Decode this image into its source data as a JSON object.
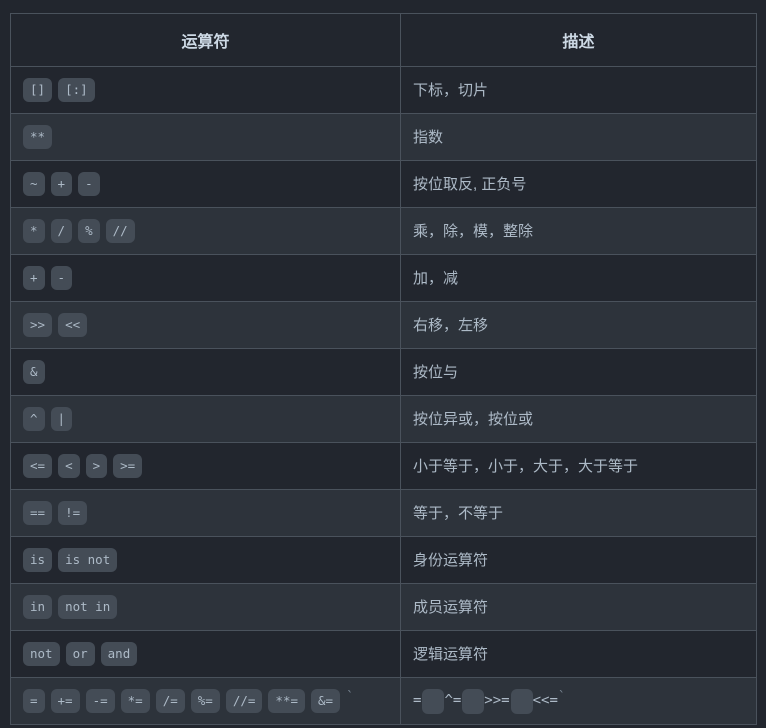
{
  "table": {
    "headers": {
      "operator": "运算符",
      "description": "描述"
    },
    "rows": [
      {
        "operators": [
          "[]",
          "[:]"
        ],
        "description": "下标，切片"
      },
      {
        "operators": [
          "**"
        ],
        "description": "指数"
      },
      {
        "operators": [
          "~",
          "+",
          "-"
        ],
        "description": "按位取反, 正负号"
      },
      {
        "operators": [
          "*",
          "/",
          "%",
          "//"
        ],
        "description": "乘，除，模，整除"
      },
      {
        "operators": [
          "+",
          "-"
        ],
        "description": "加，减"
      },
      {
        "operators": [
          ">>",
          "<<"
        ],
        "description": "右移，左移"
      },
      {
        "operators": [
          "&"
        ],
        "description": "按位与"
      },
      {
        "operators": [
          "^",
          "|"
        ],
        "description": "按位异或，按位或"
      },
      {
        "operators": [
          "<=",
          "<",
          ">",
          ">="
        ],
        "description": "小于等于，小于，大于，大于等于"
      },
      {
        "operators": [
          "==",
          "!="
        ],
        "description": "等于，不等于"
      },
      {
        "operators": [
          "is",
          "is not"
        ],
        "description": "身份运算符"
      },
      {
        "operators": [
          "in",
          "not in"
        ],
        "description": "成员运算符"
      },
      {
        "operators": [
          "not",
          "or",
          "and"
        ],
        "description": "逻辑运算符"
      },
      {
        "operators": [
          "=",
          "+=",
          "-=",
          "*=",
          "/=",
          "%=",
          "//=",
          "**=",
          "&="
        ],
        "operator_trailing_tick": "`",
        "description_parts": [
          {
            "kind": "text",
            "value": "="
          },
          {
            "kind": "empty_chip",
            "value": ""
          },
          {
            "kind": "text",
            "value": "^="
          },
          {
            "kind": "empty_chip",
            "value": ""
          },
          {
            "kind": "text",
            "value": ">>="
          },
          {
            "kind": "empty_chip",
            "value": ""
          },
          {
            "kind": "text",
            "value": "<<="
          },
          {
            "kind": "tick",
            "value": "`"
          }
        ]
      }
    ]
  },
  "colors": {
    "page_background": "#22262e",
    "row_alt_background": "#2d333b",
    "border": "#4a525c",
    "chip_background": "#444c56",
    "text": "#adbac7",
    "header_text": "#cdd9e5"
  }
}
